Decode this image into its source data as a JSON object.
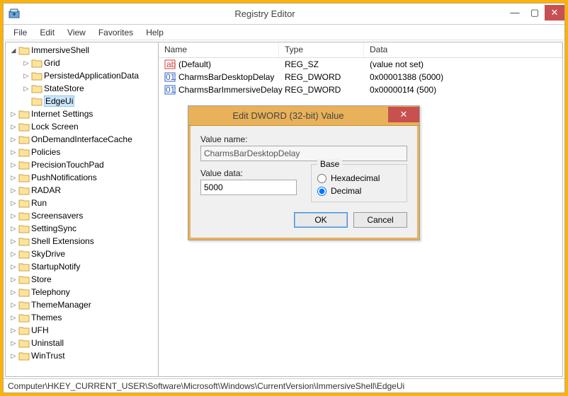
{
  "window": {
    "title": "Registry Editor",
    "min": "—",
    "max": "▢",
    "close": "✕"
  },
  "menu": [
    "File",
    "Edit",
    "View",
    "Favorites",
    "Help"
  ],
  "tree": [
    {
      "level": 0,
      "arrow": "down",
      "label": "ImmersiveShell",
      "selected": false
    },
    {
      "level": 1,
      "arrow": "right",
      "label": "Grid"
    },
    {
      "level": 1,
      "arrow": "right",
      "label": "PersistedApplicationData"
    },
    {
      "level": 1,
      "arrow": "right",
      "label": "StateStore"
    },
    {
      "level": 1,
      "arrow": "none",
      "label": "EdgeUi",
      "selected": true
    },
    {
      "level": 0,
      "arrow": "right",
      "label": "Internet Settings"
    },
    {
      "level": 0,
      "arrow": "right",
      "label": "Lock Screen"
    },
    {
      "level": 0,
      "arrow": "right",
      "label": "OnDemandInterfaceCache"
    },
    {
      "level": 0,
      "arrow": "right",
      "label": "Policies"
    },
    {
      "level": 0,
      "arrow": "right",
      "label": "PrecisionTouchPad"
    },
    {
      "level": 0,
      "arrow": "right",
      "label": "PushNotifications"
    },
    {
      "level": 0,
      "arrow": "right",
      "label": "RADAR"
    },
    {
      "level": 0,
      "arrow": "right",
      "label": "Run"
    },
    {
      "level": 0,
      "arrow": "right",
      "label": "Screensavers"
    },
    {
      "level": 0,
      "arrow": "right",
      "label": "SettingSync"
    },
    {
      "level": 0,
      "arrow": "right",
      "label": "Shell Extensions"
    },
    {
      "level": 0,
      "arrow": "right",
      "label": "SkyDrive"
    },
    {
      "level": 0,
      "arrow": "right",
      "label": "StartupNotify"
    },
    {
      "level": 0,
      "arrow": "right",
      "label": "Store"
    },
    {
      "level": 0,
      "arrow": "right",
      "label": "Telephony"
    },
    {
      "level": 0,
      "arrow": "right",
      "label": "ThemeManager"
    },
    {
      "level": 0,
      "arrow": "right",
      "label": "Themes"
    },
    {
      "level": 0,
      "arrow": "right",
      "label": "UFH"
    },
    {
      "level": 0,
      "arrow": "right",
      "label": "Uninstall"
    },
    {
      "level": 0,
      "arrow": "right",
      "label": "WinTrust"
    }
  ],
  "list": {
    "columns": [
      "Name",
      "Type",
      "Data"
    ],
    "rows": [
      {
        "icon": "str",
        "name": "(Default)",
        "type": "REG_SZ",
        "data": "(value not set)"
      },
      {
        "icon": "dword",
        "name": "CharmsBarDesktopDelay",
        "type": "REG_DWORD",
        "data": "0x00001388 (5000)"
      },
      {
        "icon": "dword",
        "name": "CharmsBarImmersiveDelay",
        "type": "REG_DWORD",
        "data": "0x000001f4 (500)"
      }
    ]
  },
  "dialog": {
    "title": "Edit DWORD (32-bit) Value",
    "close": "✕",
    "value_name_label": "Value name:",
    "value_name": "CharmsBarDesktopDelay",
    "value_data_label": "Value data:",
    "value_data": "5000",
    "base_label": "Base",
    "hex_label": "Hexadecimal",
    "dec_label": "Decimal",
    "base_selected": "dec",
    "ok": "OK",
    "cancel": "Cancel"
  },
  "statusbar": "Computer\\HKEY_CURRENT_USER\\Software\\Microsoft\\Windows\\CurrentVersion\\ImmersiveShell\\EdgeUi"
}
